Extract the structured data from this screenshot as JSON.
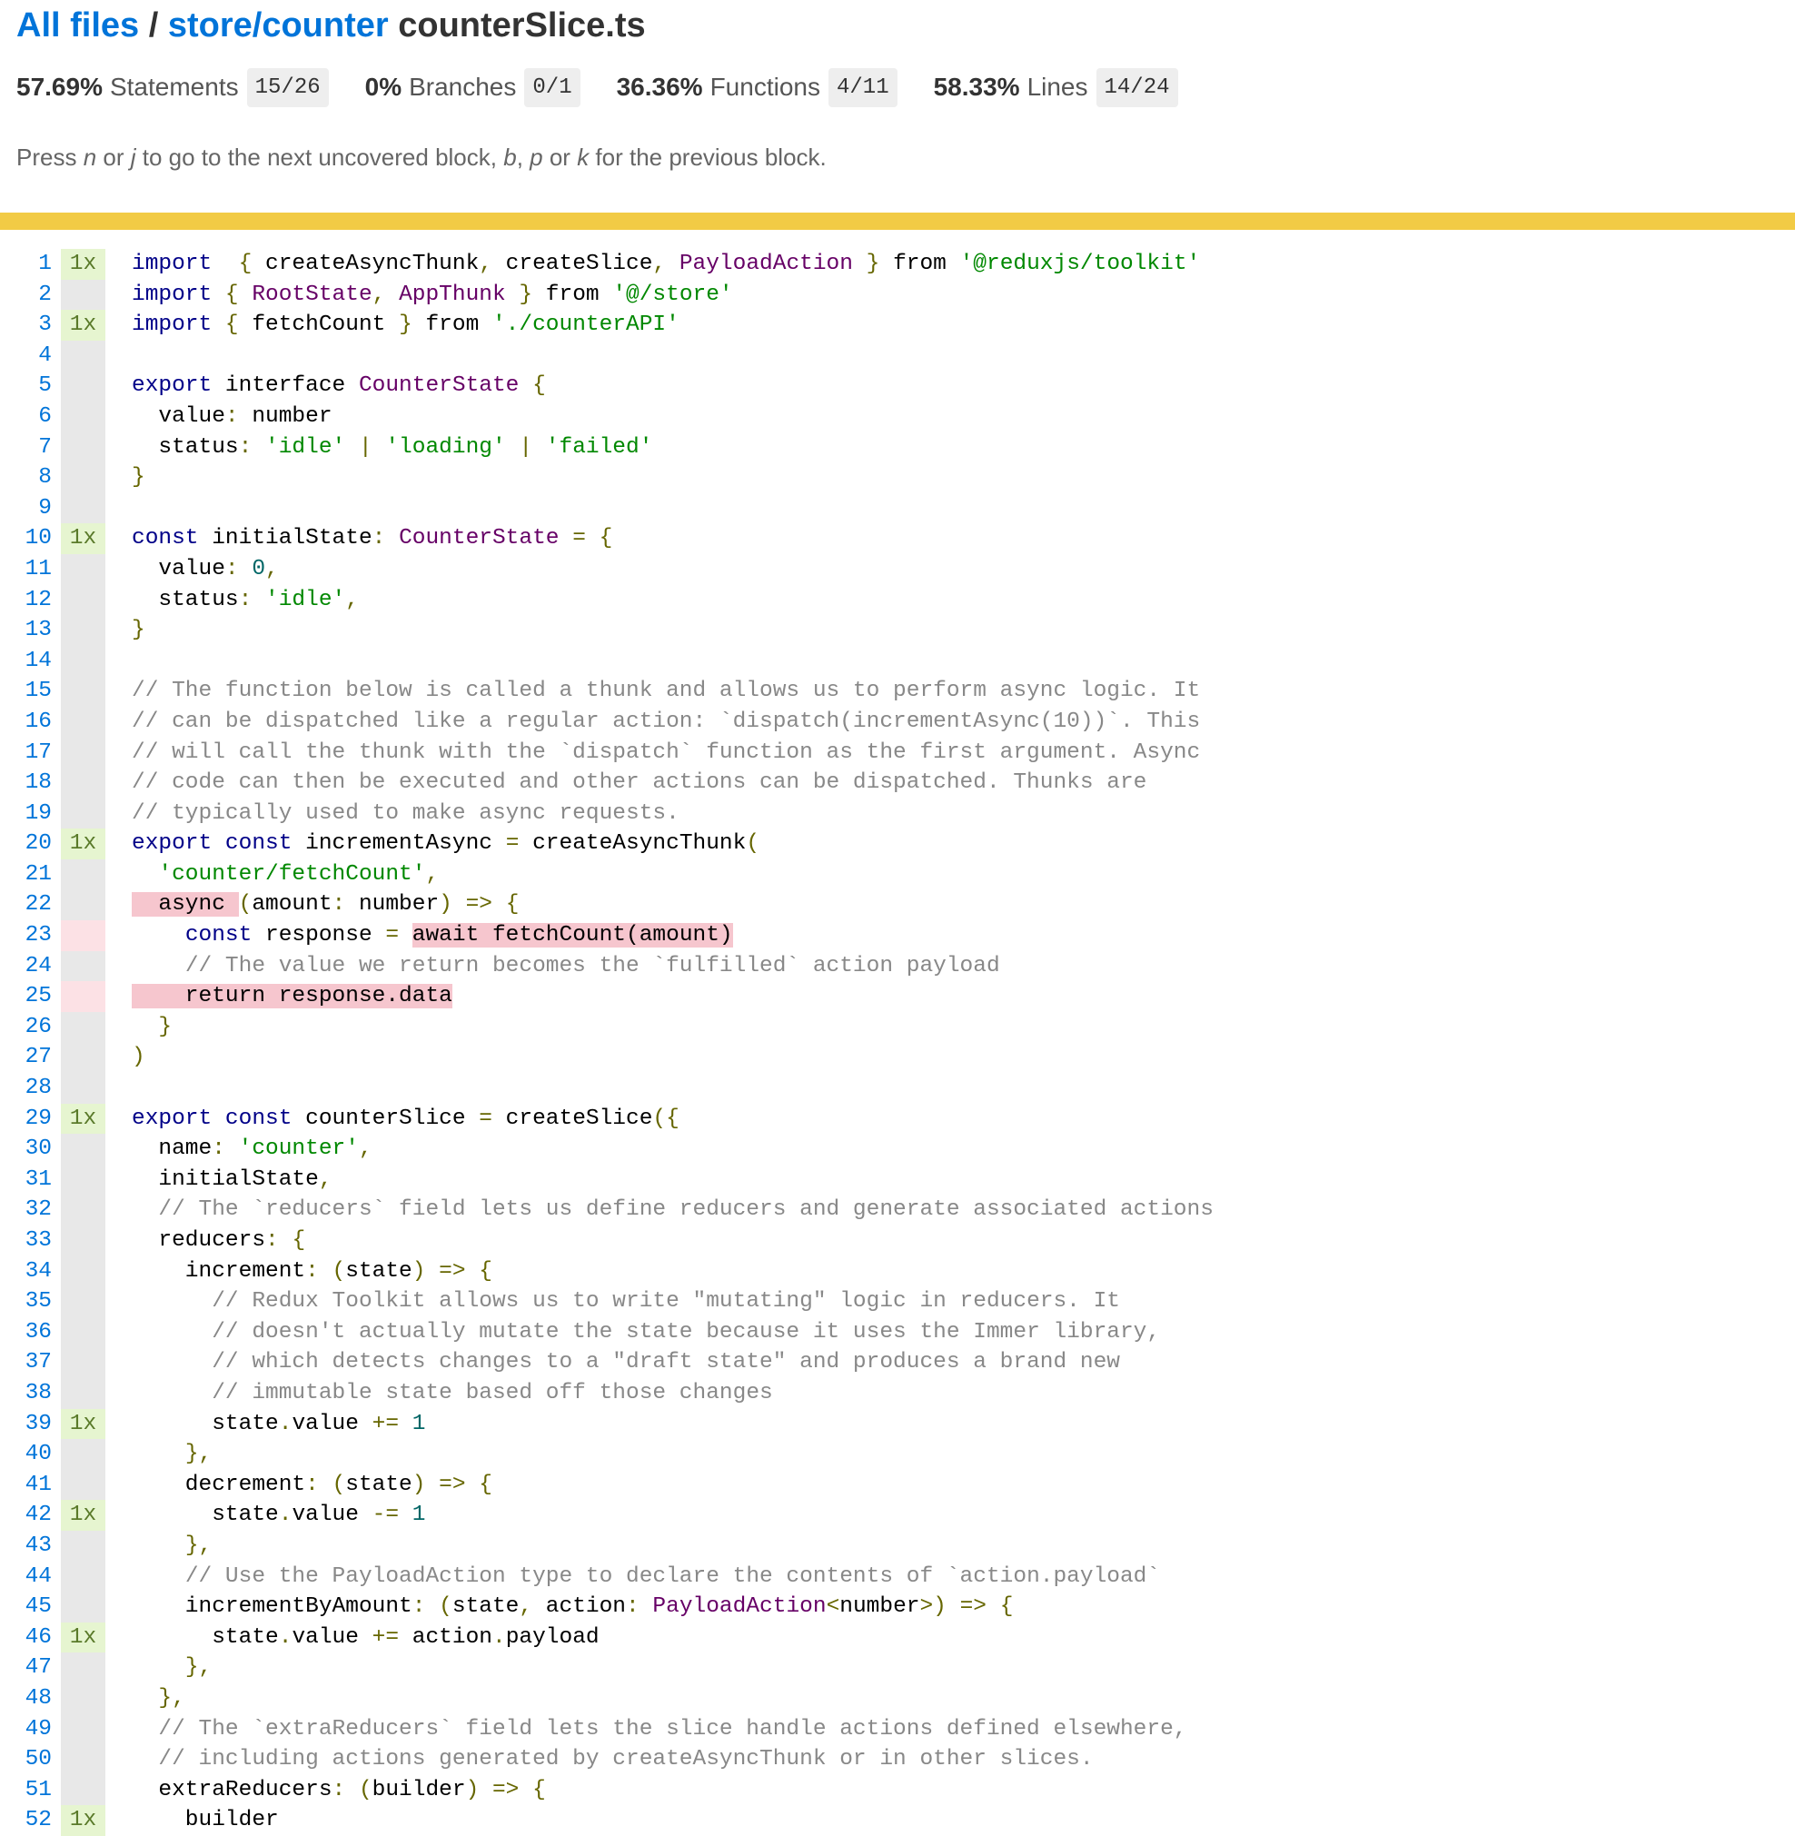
{
  "breadcrumb": {
    "root_link": "All files",
    "separator": "/",
    "dir_link": "store/counter",
    "file": "counterSlice.ts"
  },
  "summary": [
    {
      "pct": "57.69%",
      "label": "Statements",
      "fraction": "15/26"
    },
    {
      "pct": "0%",
      "label": "Branches",
      "fraction": "0/1"
    },
    {
      "pct": "36.36%",
      "label": "Functions",
      "fraction": "4/11"
    },
    {
      "pct": "58.33%",
      "label": "Lines",
      "fraction": "14/24"
    }
  ],
  "help": {
    "press": "Press ",
    "key_n": "n",
    "or1": " or ",
    "key_j": "j",
    "mid": " to go to the next uncovered block, ",
    "key_b": "b",
    "comma": ", ",
    "key_p": "p",
    "or2": " or ",
    "key_k": "k",
    "end": " for the previous block."
  },
  "coverage_bar_color": "#f2cb45",
  "colors": {
    "link": "#0074d9",
    "covered": "#e6f5d0",
    "uncovered": "#fce1e5",
    "uncovered_highlight": "#f6c6ce",
    "neutral": "#e8e8e8"
  },
  "lines": [
    {
      "n": "1",
      "count": "1x",
      "state": "yes",
      "tokens": [
        [
          "k",
          "import"
        ],
        [
          "",
          "  "
        ],
        [
          "p",
          "{"
        ],
        [
          "",
          " createAsyncThunk"
        ],
        [
          "p",
          ","
        ],
        [
          "",
          " createSlice"
        ],
        [
          "p",
          ","
        ],
        [
          "",
          " "
        ],
        [
          "t",
          "PayloadAction"
        ],
        [
          "",
          " "
        ],
        [
          "p",
          "}"
        ],
        [
          "",
          " from "
        ],
        [
          "s",
          "'@reduxjs/toolkit'"
        ]
      ]
    },
    {
      "n": "2",
      "count": "",
      "state": "",
      "tokens": [
        [
          "k",
          "import"
        ],
        [
          "",
          " "
        ],
        [
          "p",
          "{"
        ],
        [
          "",
          " "
        ],
        [
          "t",
          "RootState"
        ],
        [
          "p",
          ","
        ],
        [
          "",
          " "
        ],
        [
          "t",
          "AppThunk"
        ],
        [
          "",
          " "
        ],
        [
          "p",
          "}"
        ],
        [
          "",
          " from "
        ],
        [
          "s",
          "'@/store'"
        ]
      ]
    },
    {
      "n": "3",
      "count": "1x",
      "state": "yes",
      "tokens": [
        [
          "k",
          "import"
        ],
        [
          "",
          " "
        ],
        [
          "p",
          "{"
        ],
        [
          "",
          " fetchCount "
        ],
        [
          "p",
          "}"
        ],
        [
          "",
          " from "
        ],
        [
          "s",
          "'./counterAPI'"
        ]
      ]
    },
    {
      "n": "4",
      "count": "",
      "state": "",
      "tokens": []
    },
    {
      "n": "5",
      "count": "",
      "state": "",
      "tokens": [
        [
          "k",
          "export"
        ],
        [
          "",
          " interface "
        ],
        [
          "t",
          "CounterState"
        ],
        [
          "",
          " "
        ],
        [
          "p",
          "{"
        ]
      ]
    },
    {
      "n": "6",
      "count": "",
      "state": "",
      "tokens": [
        [
          "",
          "  value"
        ],
        [
          "p",
          ":"
        ],
        [
          "",
          " number"
        ]
      ]
    },
    {
      "n": "7",
      "count": "",
      "state": "",
      "tokens": [
        [
          "",
          "  status"
        ],
        [
          "p",
          ":"
        ],
        [
          "",
          " "
        ],
        [
          "s",
          "'idle'"
        ],
        [
          "",
          " "
        ],
        [
          "p",
          "|"
        ],
        [
          "",
          " "
        ],
        [
          "s",
          "'loading'"
        ],
        [
          "",
          " "
        ],
        [
          "p",
          "|"
        ],
        [
          "",
          " "
        ],
        [
          "s",
          "'failed'"
        ]
      ]
    },
    {
      "n": "8",
      "count": "",
      "state": "",
      "tokens": [
        [
          "p",
          "}"
        ]
      ]
    },
    {
      "n": "9",
      "count": "",
      "state": "",
      "tokens": []
    },
    {
      "n": "10",
      "count": "1x",
      "state": "yes",
      "tokens": [
        [
          "k",
          "const"
        ],
        [
          "",
          " initialState"
        ],
        [
          "p",
          ":"
        ],
        [
          "",
          " "
        ],
        [
          "t",
          "CounterState"
        ],
        [
          "",
          " "
        ],
        [
          "p",
          "="
        ],
        [
          "",
          " "
        ],
        [
          "p",
          "{"
        ]
      ]
    },
    {
      "n": "11",
      "count": "",
      "state": "",
      "tokens": [
        [
          "",
          "  value"
        ],
        [
          "p",
          ":"
        ],
        [
          "",
          " "
        ],
        [
          "n",
          "0"
        ],
        [
          "p",
          ","
        ]
      ]
    },
    {
      "n": "12",
      "count": "",
      "state": "",
      "tokens": [
        [
          "",
          "  status"
        ],
        [
          "p",
          ":"
        ],
        [
          "",
          " "
        ],
        [
          "s",
          "'idle'"
        ],
        [
          "p",
          ","
        ]
      ]
    },
    {
      "n": "13",
      "count": "",
      "state": "",
      "tokens": [
        [
          "p",
          "}"
        ]
      ]
    },
    {
      "n": "14",
      "count": "",
      "state": "",
      "tokens": []
    },
    {
      "n": "15",
      "count": "",
      "state": "",
      "tokens": [
        [
          "c",
          "// The function below is called a thunk and allows us to perform async logic. It"
        ]
      ]
    },
    {
      "n": "16",
      "count": "",
      "state": "",
      "tokens": [
        [
          "c",
          "// can be dispatched like a regular action: `dispatch(incrementAsync(10))`. This"
        ]
      ]
    },
    {
      "n": "17",
      "count": "",
      "state": "",
      "tokens": [
        [
          "c",
          "// will call the thunk with the `dispatch` function as the first argument. Async"
        ]
      ]
    },
    {
      "n": "18",
      "count": "",
      "state": "",
      "tokens": [
        [
          "c",
          "// code can then be executed and other actions can be dispatched. Thunks are"
        ]
      ]
    },
    {
      "n": "19",
      "count": "",
      "state": "",
      "tokens": [
        [
          "c",
          "// typically used to make async requests."
        ]
      ]
    },
    {
      "n": "20",
      "count": "1x",
      "state": "yes",
      "tokens": [
        [
          "k",
          "export"
        ],
        [
          "",
          " "
        ],
        [
          "k",
          "const"
        ],
        [
          "",
          " incrementAsync "
        ],
        [
          "p",
          "="
        ],
        [
          "",
          " createAsyncThunk"
        ],
        [
          "p",
          "("
        ]
      ]
    },
    {
      "n": "21",
      "count": "",
      "state": "",
      "tokens": [
        [
          "",
          "  "
        ],
        [
          "s",
          "'counter/fetchCount'"
        ],
        [
          "p",
          ","
        ]
      ]
    },
    {
      "n": "22",
      "count": "",
      "state": "",
      "tokens": [
        [
          "u",
          "  async "
        ],
        [
          "p",
          "("
        ],
        [
          "",
          "amount"
        ],
        [
          "p",
          ":"
        ],
        [
          "",
          " number"
        ],
        [
          "p",
          ")"
        ],
        [
          "",
          " "
        ],
        [
          "p",
          "=>"
        ],
        [
          "",
          " "
        ],
        [
          "p",
          "{"
        ]
      ]
    },
    {
      "n": "23",
      "count": "",
      "state": "no",
      "tokens": [
        [
          "",
          "    "
        ],
        [
          "k",
          "const"
        ],
        [
          "",
          " response "
        ],
        [
          "p",
          "="
        ],
        [
          "",
          " "
        ],
        [
          "u",
          "await fetchCount(amount)"
        ]
      ]
    },
    {
      "n": "24",
      "count": "",
      "state": "",
      "tokens": [
        [
          "",
          "    "
        ],
        [
          "c",
          "// The value we return becomes the `fulfilled` action payload"
        ]
      ]
    },
    {
      "n": "25",
      "count": "",
      "state": "no",
      "tokens": [
        [
          "u",
          "    return response.data"
        ]
      ]
    },
    {
      "n": "26",
      "count": "",
      "state": "",
      "tokens": [
        [
          "",
          "  "
        ],
        [
          "p",
          "}"
        ]
      ]
    },
    {
      "n": "27",
      "count": "",
      "state": "",
      "tokens": [
        [
          "p",
          ")"
        ]
      ]
    },
    {
      "n": "28",
      "count": "",
      "state": "",
      "tokens": []
    },
    {
      "n": "29",
      "count": "1x",
      "state": "yes",
      "tokens": [
        [
          "k",
          "export"
        ],
        [
          "",
          " "
        ],
        [
          "k",
          "const"
        ],
        [
          "",
          " counterSlice "
        ],
        [
          "p",
          "="
        ],
        [
          "",
          " createSlice"
        ],
        [
          "p",
          "({"
        ]
      ]
    },
    {
      "n": "30",
      "count": "",
      "state": "",
      "tokens": [
        [
          "",
          "  name"
        ],
        [
          "p",
          ":"
        ],
        [
          "",
          " "
        ],
        [
          "s",
          "'counter'"
        ],
        [
          "p",
          ","
        ]
      ]
    },
    {
      "n": "31",
      "count": "",
      "state": "",
      "tokens": [
        [
          "",
          "  initialState"
        ],
        [
          "p",
          ","
        ]
      ]
    },
    {
      "n": "32",
      "count": "",
      "state": "",
      "tokens": [
        [
          "",
          "  "
        ],
        [
          "c",
          "// The `reducers` field lets us define reducers and generate associated actions"
        ]
      ]
    },
    {
      "n": "33",
      "count": "",
      "state": "",
      "tokens": [
        [
          "",
          "  reducers"
        ],
        [
          "p",
          ":"
        ],
        [
          "",
          " "
        ],
        [
          "p",
          "{"
        ]
      ]
    },
    {
      "n": "34",
      "count": "",
      "state": "",
      "tokens": [
        [
          "",
          "    increment"
        ],
        [
          "p",
          ":"
        ],
        [
          "",
          " "
        ],
        [
          "p",
          "("
        ],
        [
          "",
          "state"
        ],
        [
          "p",
          ")"
        ],
        [
          "",
          " "
        ],
        [
          "p",
          "=>"
        ],
        [
          "",
          " "
        ],
        [
          "p",
          "{"
        ]
      ]
    },
    {
      "n": "35",
      "count": "",
      "state": "",
      "tokens": [
        [
          "",
          "      "
        ],
        [
          "c",
          "// Redux Toolkit allows us to write \"mutating\" logic in reducers. It"
        ]
      ]
    },
    {
      "n": "36",
      "count": "",
      "state": "",
      "tokens": [
        [
          "",
          "      "
        ],
        [
          "c",
          "// doesn't actually mutate the state because it uses the Immer library,"
        ]
      ]
    },
    {
      "n": "37",
      "count": "",
      "state": "",
      "tokens": [
        [
          "",
          "      "
        ],
        [
          "c",
          "// which detects changes to a \"draft state\" and produces a brand new"
        ]
      ]
    },
    {
      "n": "38",
      "count": "",
      "state": "",
      "tokens": [
        [
          "",
          "      "
        ],
        [
          "c",
          "// immutable state based off those changes"
        ]
      ]
    },
    {
      "n": "39",
      "count": "1x",
      "state": "yes",
      "tokens": [
        [
          "",
          "      state"
        ],
        [
          "p",
          "."
        ],
        [
          "",
          "value "
        ],
        [
          "p",
          "+="
        ],
        [
          "",
          " "
        ],
        [
          "n",
          "1"
        ]
      ]
    },
    {
      "n": "40",
      "count": "",
      "state": "",
      "tokens": [
        [
          "",
          "    "
        ],
        [
          "p",
          "},"
        ]
      ]
    },
    {
      "n": "41",
      "count": "",
      "state": "",
      "tokens": [
        [
          "",
          "    decrement"
        ],
        [
          "p",
          ":"
        ],
        [
          "",
          " "
        ],
        [
          "p",
          "("
        ],
        [
          "",
          "state"
        ],
        [
          "p",
          ")"
        ],
        [
          "",
          " "
        ],
        [
          "p",
          "=>"
        ],
        [
          "",
          " "
        ],
        [
          "p",
          "{"
        ]
      ]
    },
    {
      "n": "42",
      "count": "1x",
      "state": "yes",
      "tokens": [
        [
          "",
          "      state"
        ],
        [
          "p",
          "."
        ],
        [
          "",
          "value "
        ],
        [
          "p",
          "-="
        ],
        [
          "",
          " "
        ],
        [
          "n",
          "1"
        ]
      ]
    },
    {
      "n": "43",
      "count": "",
      "state": "",
      "tokens": [
        [
          "",
          "    "
        ],
        [
          "p",
          "},"
        ]
      ]
    },
    {
      "n": "44",
      "count": "",
      "state": "",
      "tokens": [
        [
          "",
          "    "
        ],
        [
          "c",
          "// Use the PayloadAction type to declare the contents of `action.payload`"
        ]
      ]
    },
    {
      "n": "45",
      "count": "",
      "state": "",
      "tokens": [
        [
          "",
          "    incrementByAmount"
        ],
        [
          "p",
          ":"
        ],
        [
          "",
          " "
        ],
        [
          "p",
          "("
        ],
        [
          "",
          "state"
        ],
        [
          "p",
          ","
        ],
        [
          "",
          " action"
        ],
        [
          "p",
          ":"
        ],
        [
          "",
          " "
        ],
        [
          "t",
          "PayloadAction"
        ],
        [
          "p",
          "<"
        ],
        [
          "",
          "number"
        ],
        [
          "p",
          ">)"
        ],
        [
          "",
          " "
        ],
        [
          "p",
          "=>"
        ],
        [
          "",
          " "
        ],
        [
          "p",
          "{"
        ]
      ]
    },
    {
      "n": "46",
      "count": "1x",
      "state": "yes",
      "tokens": [
        [
          "",
          "      state"
        ],
        [
          "p",
          "."
        ],
        [
          "",
          "value "
        ],
        [
          "p",
          "+="
        ],
        [
          "",
          " action"
        ],
        [
          "p",
          "."
        ],
        [
          "",
          "payload"
        ]
      ]
    },
    {
      "n": "47",
      "count": "",
      "state": "",
      "tokens": [
        [
          "",
          "    "
        ],
        [
          "p",
          "},"
        ]
      ]
    },
    {
      "n": "48",
      "count": "",
      "state": "",
      "tokens": [
        [
          "",
          "  "
        ],
        [
          "p",
          "},"
        ]
      ]
    },
    {
      "n": "49",
      "count": "",
      "state": "",
      "tokens": [
        [
          "",
          "  "
        ],
        [
          "c",
          "// The `extraReducers` field lets the slice handle actions defined elsewhere,"
        ]
      ]
    },
    {
      "n": "50",
      "count": "",
      "state": "",
      "tokens": [
        [
          "",
          "  "
        ],
        [
          "c",
          "// including actions generated by createAsyncThunk or in other slices."
        ]
      ]
    },
    {
      "n": "51",
      "count": "",
      "state": "",
      "tokens": [
        [
          "",
          "  extraReducers"
        ],
        [
          "p",
          ":"
        ],
        [
          "",
          " "
        ],
        [
          "p",
          "("
        ],
        [
          "",
          "builder"
        ],
        [
          "p",
          ")"
        ],
        [
          "",
          " "
        ],
        [
          "p",
          "=>"
        ],
        [
          "",
          " "
        ],
        [
          "p",
          "{"
        ]
      ]
    },
    {
      "n": "52",
      "count": "1x",
      "state": "yes",
      "tokens": [
        [
          "",
          "    builder"
        ]
      ]
    }
  ]
}
